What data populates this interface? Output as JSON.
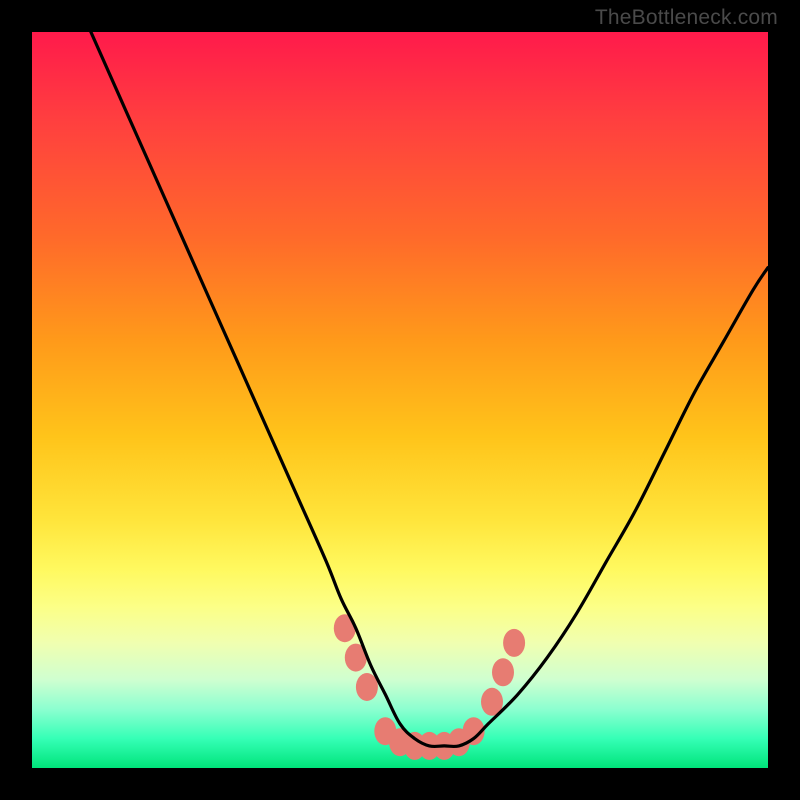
{
  "watermark": "TheBottleneck.com",
  "colors": {
    "frame": "#000000",
    "curve": "#000000",
    "markers": "#e77c72",
    "gradient_stops": [
      "#ff1a4b",
      "#ff3f3f",
      "#ff6a2a",
      "#ff9a1a",
      "#ffc41a",
      "#ffe43a",
      "#fff95f",
      "#fcff86",
      "#f0ffb0",
      "#cfffd0",
      "#8cffd0",
      "#35ffb6",
      "#00e47a"
    ]
  },
  "chart_data": {
    "type": "line",
    "title": "",
    "xlabel": "",
    "ylabel": "",
    "xlim": [
      0,
      100
    ],
    "ylim": [
      0,
      100
    ],
    "grid": false,
    "legend": false,
    "series": [
      {
        "name": "bottleneck-curve",
        "x": [
          8,
          12,
          16,
          20,
          24,
          28,
          32,
          36,
          40,
          42,
          44,
          46,
          48,
          50,
          52,
          54,
          56,
          58,
          60,
          62,
          66,
          70,
          74,
          78,
          82,
          86,
          90,
          94,
          98,
          100
        ],
        "y": [
          100,
          91,
          82,
          73,
          64,
          55,
          46,
          37,
          28,
          23,
          19,
          14,
          10,
          6,
          4,
          3,
          3,
          3,
          4,
          6,
          10,
          15,
          21,
          28,
          35,
          43,
          51,
          58,
          65,
          68
        ]
      }
    ],
    "markers": [
      {
        "x": 42.5,
        "y": 19
      },
      {
        "x": 44.0,
        "y": 15
      },
      {
        "x": 45.5,
        "y": 11
      },
      {
        "x": 48.0,
        "y": 5
      },
      {
        "x": 50.0,
        "y": 3.5
      },
      {
        "x": 52.0,
        "y": 3
      },
      {
        "x": 54.0,
        "y": 3
      },
      {
        "x": 56.0,
        "y": 3
      },
      {
        "x": 58.0,
        "y": 3.5
      },
      {
        "x": 60.0,
        "y": 5
      },
      {
        "x": 62.5,
        "y": 9
      },
      {
        "x": 64.0,
        "y": 13
      },
      {
        "x": 65.5,
        "y": 17
      }
    ]
  }
}
